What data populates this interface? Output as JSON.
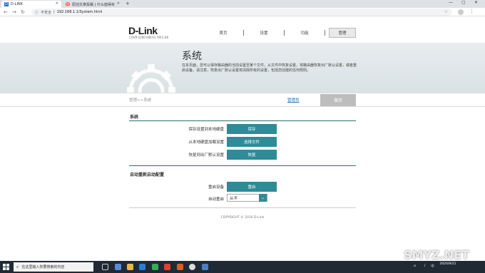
{
  "browser": {
    "tabs": [
      {
        "title": "D-LINK",
        "active": true
      },
      {
        "title": "原创文章投稿 | 什么值得买",
        "active": false
      }
    ],
    "new_tab": "+",
    "security_label": "不安全",
    "url": "192.168.1.1/System.html",
    "window_controls": {
      "minimize": "—",
      "maximize": "▢",
      "close": "✕"
    }
  },
  "header": {
    "brand": "D-Link",
    "model": "COVR-2200 HW:A1 FW:1.06",
    "nav": [
      {
        "label": "首页",
        "selected": false
      },
      {
        "label": "设置",
        "selected": false
      },
      {
        "label": "功能",
        "selected": false
      },
      {
        "label": "管理",
        "selected": true
      }
    ]
  },
  "banner": {
    "title": "系统",
    "description": "在本页面，您可以保存路由器的当前设置至某个文件，从文件中恢复设置，将路由器恢复出厂默认设置，或者重启设备。请注意，恢复出厂默认设置将清除所有的设置，包括您创建的任何规则。"
  },
  "toolstrip": {
    "breadcrumb": "管理>>系统",
    "mgmt_link": "管理员",
    "save_label": "保存"
  },
  "system_section": {
    "title": "系统",
    "rows": [
      {
        "label": "保存设置到本地硬盘",
        "button": "保存"
      },
      {
        "label": "从本地硬盘加载设置",
        "button": "选择文件"
      },
      {
        "label": "恢复到出厂默认设置",
        "button": "恢复"
      }
    ]
  },
  "reboot_section": {
    "title": "自动重新启动配置",
    "reboot_label": "重启设备",
    "reboot_button": "重启",
    "auto_label": "自动重启",
    "auto_value": "从不"
  },
  "footer": {
    "copyright": "COPYRIGHT © 2016 D-Link"
  },
  "taskbar": {
    "search_placeholder": "在这里输入你要搜索的内容",
    "time": "",
    "date": "2020/9/21",
    "language": "中"
  },
  "watermark": "SMYZ.NET"
}
